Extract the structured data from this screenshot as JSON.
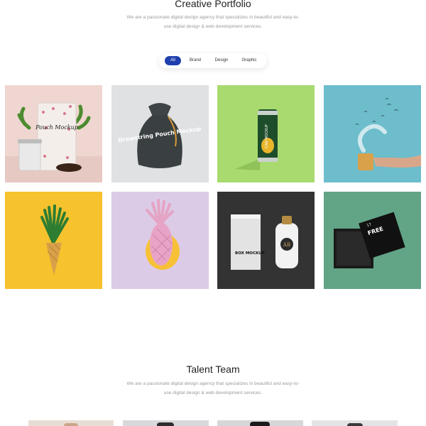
{
  "portfolio": {
    "title": "Creative Portfolio",
    "subtitle_line1": "We are a passionate digital design agency that specializes in beautiful and easy-to-",
    "subtitle_line2": "use digital design & web development services.",
    "filters": [
      {
        "label": "All",
        "active": true
      },
      {
        "label": "Brand",
        "active": false
      },
      {
        "label": "Design",
        "active": false
      },
      {
        "label": "Graphic",
        "active": false
      }
    ],
    "items": [
      {
        "subject": "coffee pouch mockup",
        "printed_text": "Pouch Mockup"
      },
      {
        "subject": "drawstring pouch mockup",
        "printed_text": "Drawstring Pouch Mockup"
      },
      {
        "subject": "can mockup",
        "printed_text": "CAN MOCKUP"
      },
      {
        "subject": "mug with birds",
        "printed_text": ""
      },
      {
        "subject": "pineapple cone",
        "printed_text": ""
      },
      {
        "subject": "pink pineapple",
        "printed_text": ""
      },
      {
        "subject": "box and bottle mockup",
        "printed_text": "BOX MOCKUP",
        "logo_text": "AB"
      },
      {
        "subject": "free box mockup",
        "printed_text": "FREE",
        "logo_text": "17"
      }
    ]
  },
  "team": {
    "title": "Talent Team",
    "subtitle_line1": "We are a passionate digital design agency that specializes in beautiful and easy-to-",
    "subtitle_line2": "use digital design & web development services."
  },
  "colors": {
    "accent": "#1f3fae",
    "tile_pink": "#efd6d0",
    "tile_grey": "#dfe1e3",
    "tile_green": "#a8da6f",
    "tile_teal": "#6dbdcc",
    "tile_yellow": "#f6c22d",
    "tile_lilac": "#dccbe7",
    "tile_dark": "#333333",
    "tile_sage": "#62a486"
  }
}
